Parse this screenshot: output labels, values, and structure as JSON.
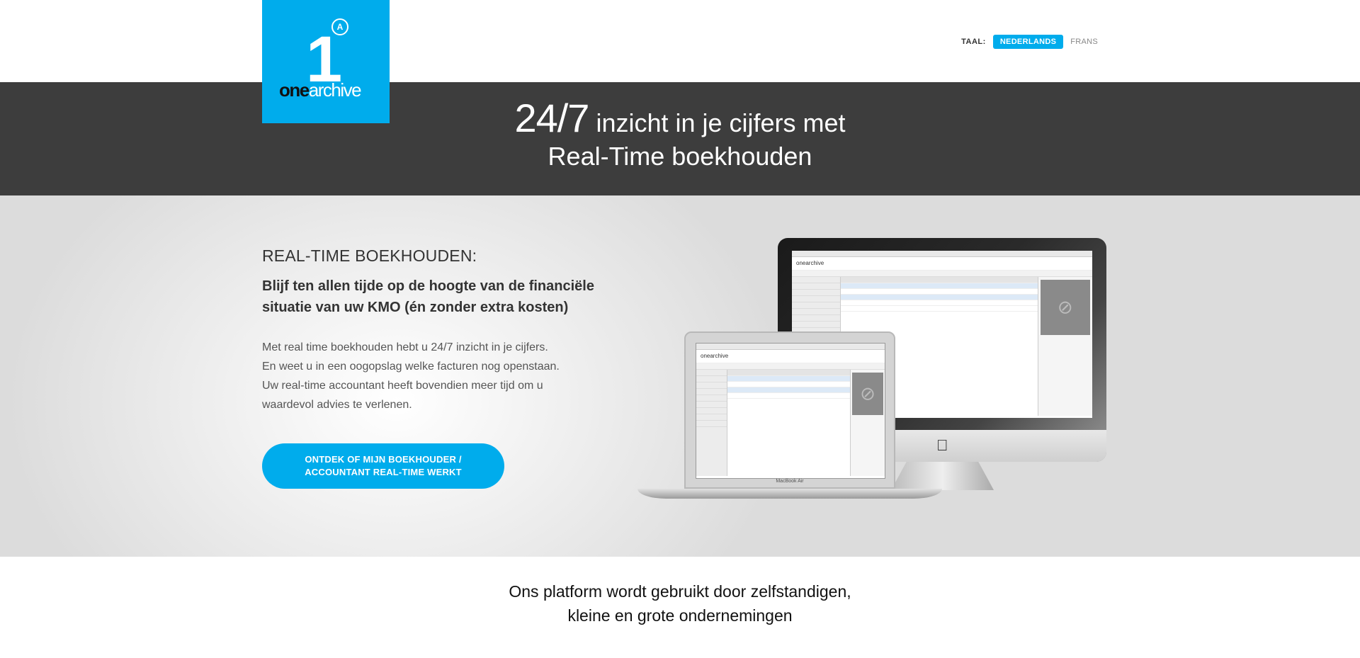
{
  "brand": {
    "logo_numeral": "1",
    "logo_badge": "A",
    "logo_word_bold": "one",
    "logo_word_light": "archive"
  },
  "language": {
    "label": "TAAL:",
    "active": "NEDERLANDS",
    "other": "FRANS"
  },
  "hero": {
    "big": "24/7",
    "line1_rest": " inzicht in je cijfers met",
    "line2": "Real-Time boekhouden"
  },
  "feature": {
    "heading": "REAL-TIME BOEKHOUDEN:",
    "subheading": "Blijf ten allen tijde op de hoogte van de financiële situatie van uw KMO (én zonder extra kosten)",
    "body_lines": [
      "Met real time boekhouden hebt u 24/7 inzicht in je cijfers.",
      "En weet u in een oogopslag welke facturen nog openstaan.",
      "Uw real-time accountant heeft bovendien meer tijd om u",
      "waardevol advies te verlenen."
    ],
    "cta_line1": "ONTDEK OF MIJN BOEKHOUDER /",
    "cta_line2": "ACCOUNTANT REAL-TIME WERKT"
  },
  "devices": {
    "laptop_label": "MacBook Air",
    "app_name": "onearchive"
  },
  "platform": {
    "line1": "Ons platform wordt gebruikt door zelfstandigen,",
    "line2": "kleine en grote ondernemingen"
  },
  "colors": {
    "accent": "#00acec",
    "hero_bg": "#3d3d3d"
  }
}
